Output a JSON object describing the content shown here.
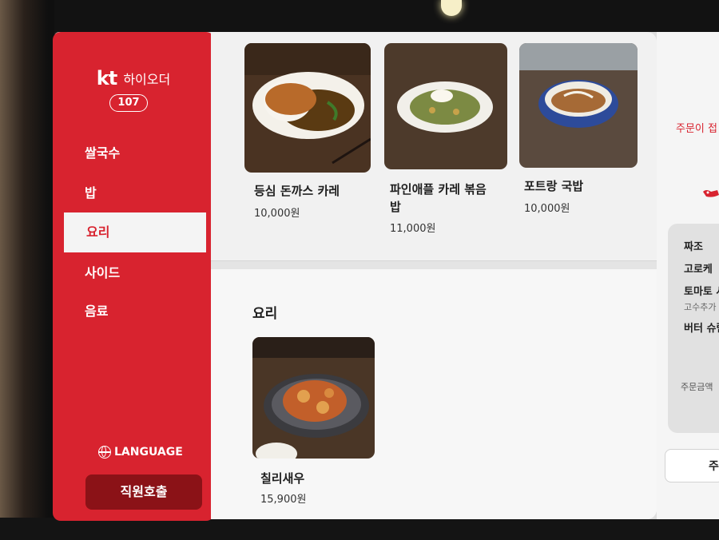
{
  "brand": {
    "logo": "kt",
    "name": "하이오더",
    "table_number": "107"
  },
  "sidebar": {
    "categories": [
      {
        "label": "쌀국수"
      },
      {
        "label": "밥"
      },
      {
        "label": "요리",
        "active": true
      },
      {
        "label": "사이드"
      },
      {
        "label": "음료"
      }
    ],
    "language_label": "LANGUAGE",
    "call_staff_label": "직원호출"
  },
  "menu_top": [
    {
      "name": "등심 돈까스 카레",
      "price": "10,000원",
      "image": "tonkatsu-curry-photo"
    },
    {
      "name": "파인애플 카레 볶음\n밥",
      "price": "11,000원",
      "image": "pineapple-curry-fried-rice-photo"
    },
    {
      "name": "포트랑 국밥",
      "price": "10,000원",
      "image": "pho-gukbap-photo"
    }
  ],
  "section": {
    "title": "요리",
    "items": [
      {
        "name": "칠리새우",
        "price": "15,900원",
        "image": "chili-shrimp-photo"
      }
    ]
  },
  "order_panel": {
    "status_text": "주문이 접",
    "items": [
      {
        "label": "짜조"
      },
      {
        "label": "고로케"
      },
      {
        "label": "토마토 샤",
        "option": "고수추가"
      },
      {
        "label": "버터 슈림"
      }
    ],
    "total_label": "주문금액",
    "order_button_label": "주"
  },
  "colors": {
    "accent": "#d8232f",
    "call_button": "#8b1217",
    "content_bg": "#f1f1f1"
  }
}
